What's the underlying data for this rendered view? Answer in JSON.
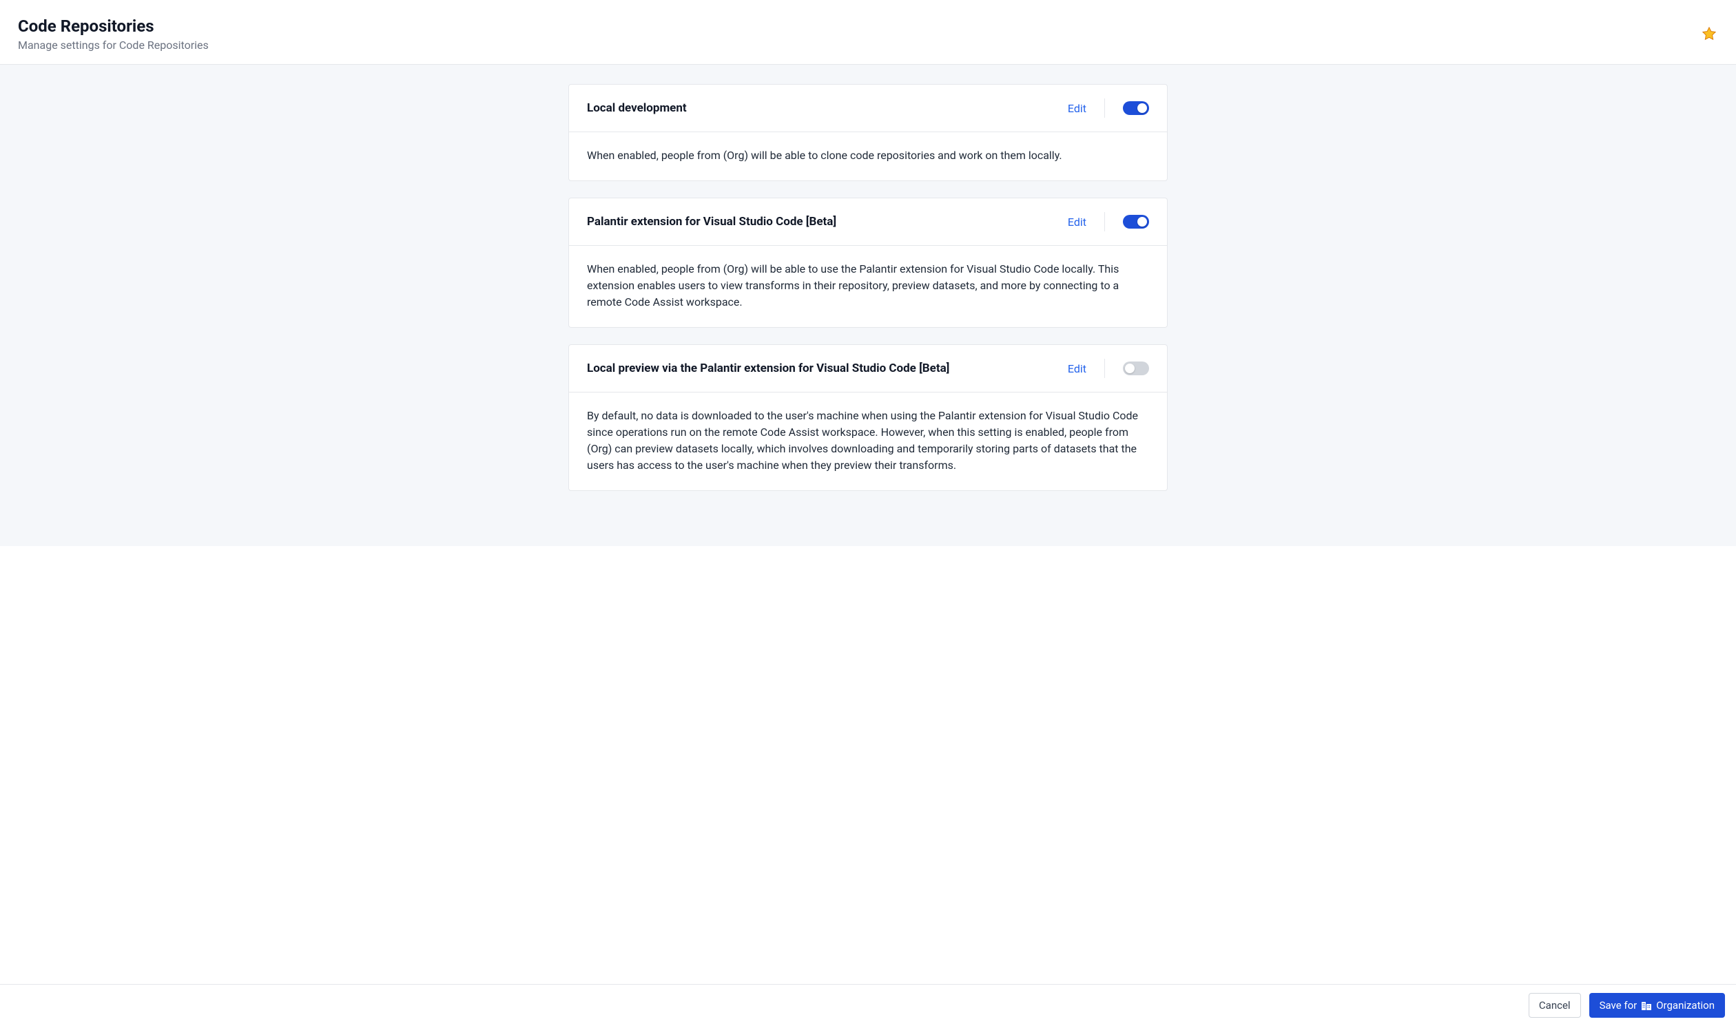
{
  "header": {
    "title": "Code Repositories",
    "subtitle": "Manage settings for Code Repositories"
  },
  "settings": [
    {
      "title": "Local development",
      "edit_label": "Edit",
      "enabled": true,
      "description": "When enabled, people from (Org) will be able to clone code repositories and work on them locally."
    },
    {
      "title": "Palantir extension for Visual Studio Code [Beta]",
      "edit_label": "Edit",
      "enabled": true,
      "description": "When enabled, people from (Org) will be able to use the Palantir extension for Visual Studio Code locally. This extension enables users to view transforms in their repository, preview datasets, and more by connecting to a remote Code Assist workspace."
    },
    {
      "title": "Local preview via the Palantir extension for Visual Studio Code [Beta]",
      "edit_label": "Edit",
      "enabled": false,
      "description": "By default, no data is downloaded to the user's machine when using the Palantir extension for Visual Studio Code since operations run on the remote Code Assist workspace. However, when this setting is enabled, people from (Org) can preview datasets locally, which involves downloading and temporarily storing parts of datasets that the users has access to the user's machine when they preview their transforms."
    }
  ],
  "footer": {
    "cancel_label": "Cancel",
    "save_prefix": "Save for",
    "save_target": "Organization"
  }
}
